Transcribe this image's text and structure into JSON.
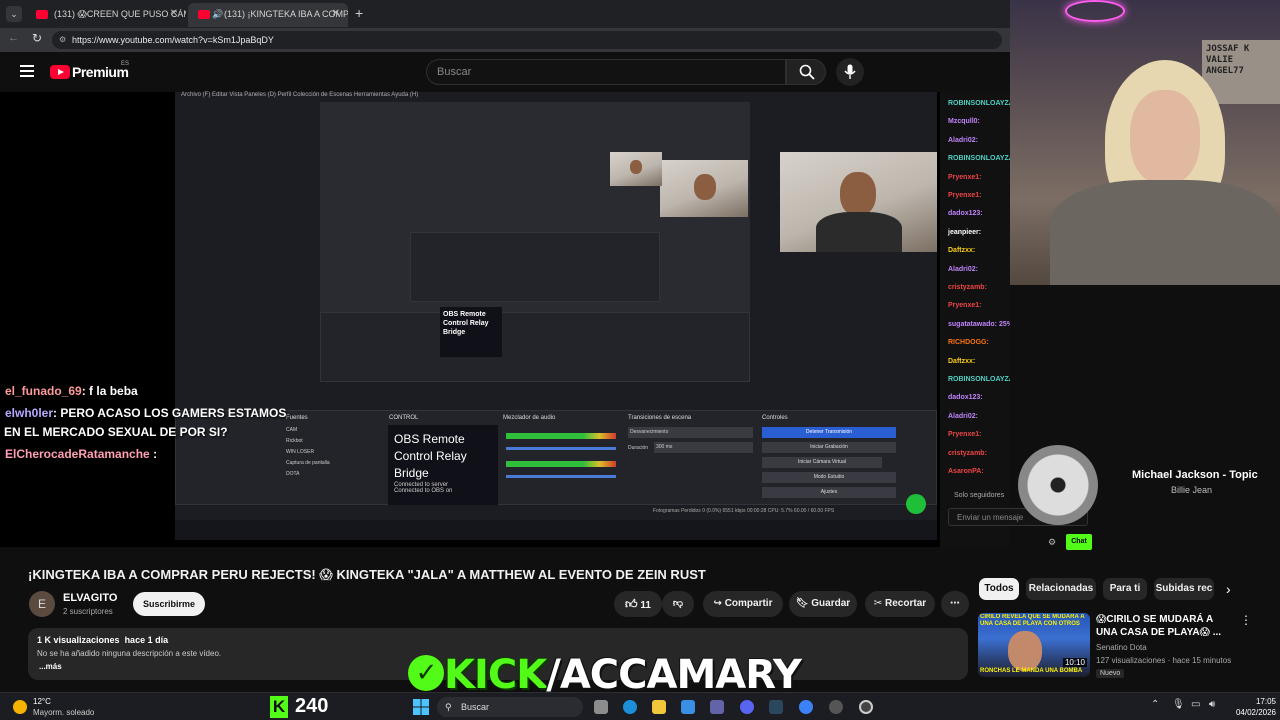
{
  "browser": {
    "tabs": [
      {
        "title": "(131) 😱CREEN QUE PUSO CÁMA"
      },
      {
        "title": "(131) ¡KINGTEKA IBA A COMPR"
      }
    ],
    "url": "https://www.youtube.com/watch?v=kSm1JpaBqDY",
    "new_tab": "+"
  },
  "youtube": {
    "logo": "Premium",
    "logo_region": "ES",
    "search_placeholder": "Buscar"
  },
  "obs": {
    "menu": "Archivo (F)   Editar   Vista   Paneles (D)   Perfil   Colección de Escenas   Herramientas   Ayuda (H)",
    "panels": {
      "sources": "Fuentes",
      "control": "CONTROL",
      "mixer": "Mezclador de audio",
      "transitions": "Transiciones de escena",
      "controls": "Controles"
    },
    "bridge_title": "OBS Remote Control Relay Bridge",
    "bridge_line1": "Connected to server",
    "bridge_line2": "Connected to OBS on",
    "sources": [
      "CAM",
      "Rickbot",
      "WIN LOSER",
      "Captura de pantalla",
      "DOTA"
    ],
    "transition": "Desvanecimiento",
    "duration_label": "Duración",
    "duration": "300 ms",
    "controls": [
      "Detener Transmisión",
      "Iniciar Grabación",
      "Iniciar Cámara Virtual",
      "Modo Estudio",
      "Ajustes"
    ],
    "status": "Fotogramas Perdidos 0 (0.0%)   6551 kbps   00:00:28   CPU: 5.7%   60.00 / 60.00 FPS"
  },
  "overlay_chat": [
    {
      "user": "el_funado_69",
      "message": ": f la beba"
    },
    {
      "user": "elwh0ler",
      "message": ": PERO ACASO LOS GAMERS ESTAMOS"
    },
    {
      "user": "",
      "message": "EN EL MERCADO SEXUAL DE POR SI?"
    },
    {
      "user": "ElCherocadeRatamanche",
      "message": " :"
    }
  ],
  "side_chat": [
    {
      "user": "ROBINSONLOAYZA:",
      "color": "#4fd1c5"
    },
    {
      "user": "Mzcqull0:",
      "color": "#c084fc"
    },
    {
      "user": "Aladri02:",
      "color": "#c084fc"
    },
    {
      "user": "ROBINSONLOAYZA:",
      "color": "#4fd1c5"
    },
    {
      "user": "Pryenxe1:",
      "color": "#ef4444"
    },
    {
      "user": "Pryenxe1:",
      "color": "#ef4444"
    },
    {
      "user": "dadox123:",
      "color": "#c084fc"
    },
    {
      "user": "jeanpieer:",
      "color": "#ffffff"
    },
    {
      "user": "Daftzxx:",
      "color": "#facc15"
    },
    {
      "user": "Aladri02:",
      "color": "#c084fc"
    },
    {
      "user": "cristyzamb:",
      "color": "#ef4444"
    },
    {
      "user": "Pryenxe1:",
      "color": "#ef4444"
    },
    {
      "user": "sugatatawado: 25%",
      "color": "#c084fc"
    },
    {
      "user": "RICHDOGG:",
      "color": "#f97316"
    },
    {
      "user": "Daftzxx:",
      "color": "#facc15"
    },
    {
      "user": "ROBINSONLOAYZA:",
      "color": "#4fd1c5"
    },
    {
      "user": "dadox123:",
      "color": "#c084fc"
    },
    {
      "user": "Aladri02:",
      "color": "#c084fc"
    },
    {
      "user": "Pryenxe1:",
      "color": "#ef4444"
    },
    {
      "user": "cristyzamb:",
      "color": "#ef4444"
    },
    {
      "user": "AsaronPA:",
      "color": "#ef4444"
    }
  ],
  "side_chat_footer": {
    "followers": "Solo seguidores",
    "send_placeholder": "Enviar un mensaje",
    "chat_button": "Chat"
  },
  "streamer_sign": [
    "JOSSAF K",
    "VALIE",
    "ANGEL77"
  ],
  "music": {
    "artist": "Michael Jackson - Topic",
    "song": "Billie Jean"
  },
  "video": {
    "title": "¡KINGTEKA IBA A COMPRAR PERU REJECTS! 😱 KINGTEKA \"JALA\" A MATTHEW AL EVENTO DE ZEIN RUST",
    "channel_initial": "E",
    "channel": "ELVAGITO",
    "subscribers": "2 suscriptores",
    "subscribe": "Suscribirme",
    "likes": "11",
    "share": "Compartir",
    "save": "Guardar",
    "clip": "Recortar",
    "views": "1 K visualizaciones",
    "age": "hace 1 día",
    "description": "No se ha añadido ninguna descripción a este vídeo.",
    "more": "...más"
  },
  "recommendations": {
    "chips": [
      "Todos",
      "Relacionadas",
      "Para ti",
      "Subidas rec"
    ],
    "items": [
      {
        "title": "😱CIRILO SE MUDARÁ A UNA CASA DE PLAYA😱 ...",
        "channel": "Senatino Dota",
        "meta": "127 visualizaciones · hace 15 minutos",
        "badge": "Nuevo",
        "duration": "10:10",
        "thumb_text": "CIRILO REVELA QUE SE MUDARÁ A UNA CASA DE PLAYA CON OTROS STREAMERS",
        "thumb_bottom": "RONCHAS LE MANDA UNA BOMBA"
      }
    ]
  },
  "kick_banner": {
    "part1": "KICK",
    "part2": "/ACCAMARY"
  },
  "taskbar": {
    "weather_temp": "12°C",
    "weather_desc": "Mayorm. soleado",
    "kick_count": "240",
    "search": "Buscar",
    "time": "17:05",
    "date": "04/02/2026"
  }
}
